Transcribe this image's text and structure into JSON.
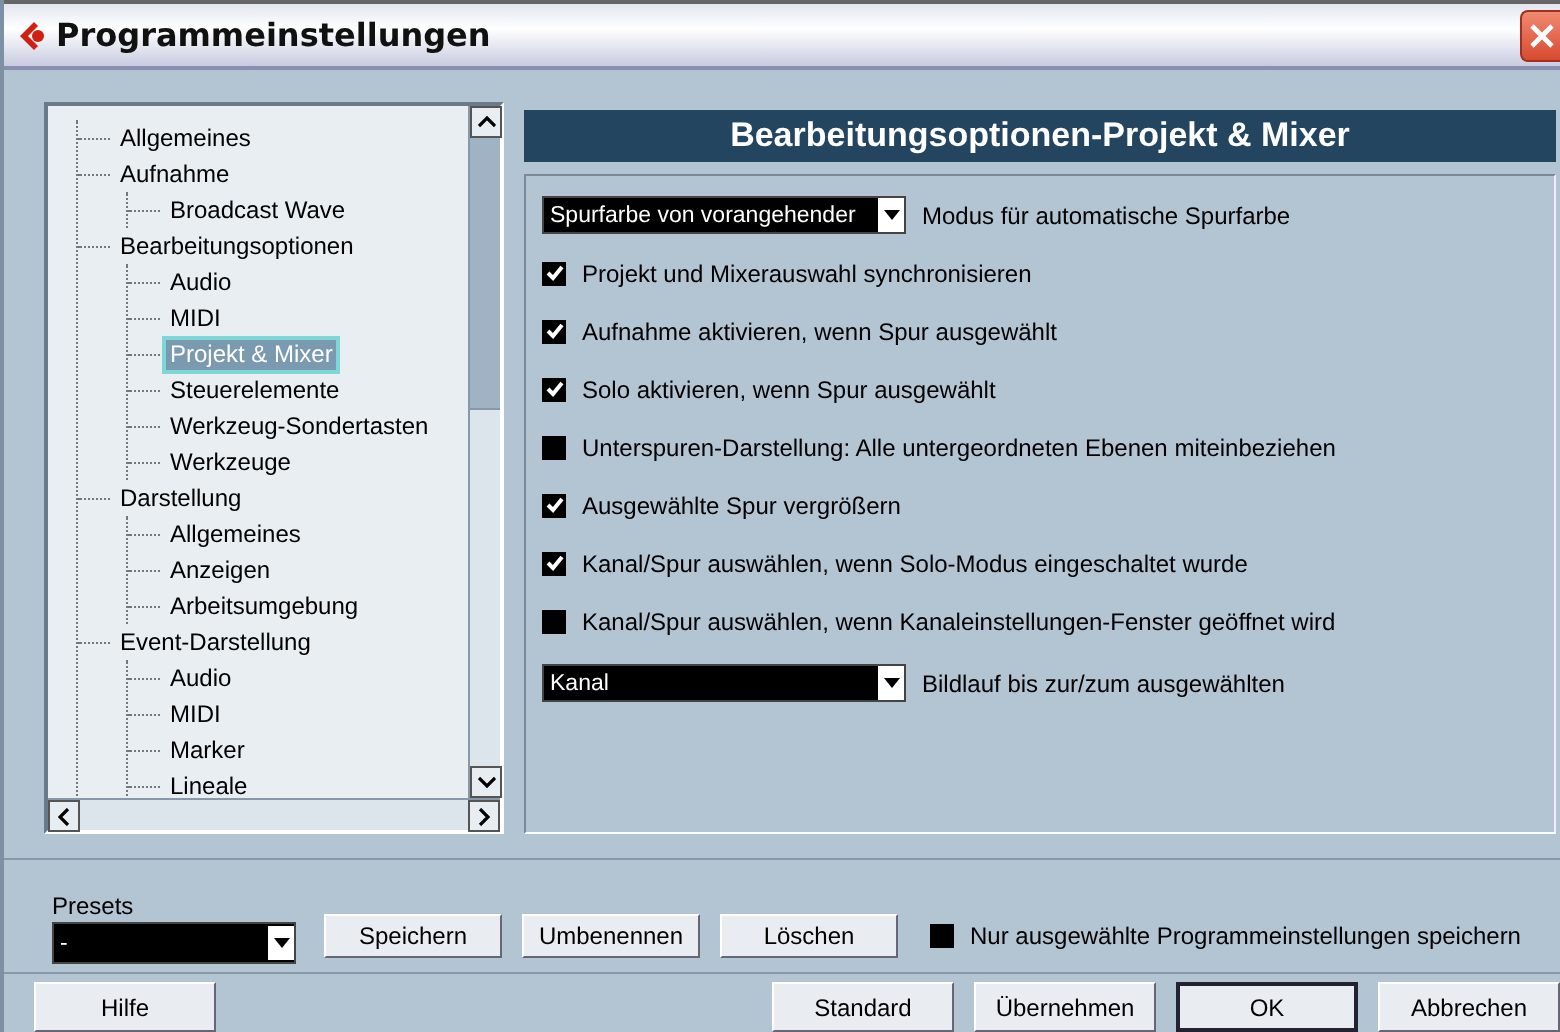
{
  "window": {
    "title": "Programmeinstellungen"
  },
  "tree": {
    "items": [
      {
        "label": "Allgemeines",
        "selected": false
      },
      {
        "label": "Aufnahme",
        "selected": false,
        "children": [
          {
            "label": "Broadcast Wave",
            "selected": false
          }
        ]
      },
      {
        "label": "Bearbeitungsoptionen",
        "selected": false,
        "children": [
          {
            "label": "Audio",
            "selected": false
          },
          {
            "label": "MIDI",
            "selected": false
          },
          {
            "label": "Projekt & Mixer",
            "selected": true
          },
          {
            "label": "Steuerelemente",
            "selected": false
          },
          {
            "label": "Werkzeug-Sondertasten",
            "selected": false
          },
          {
            "label": "Werkzeuge",
            "selected": false
          }
        ]
      },
      {
        "label": "Darstellung",
        "selected": false,
        "children": [
          {
            "label": "Allgemeines",
            "selected": false
          },
          {
            "label": "Anzeigen",
            "selected": false
          },
          {
            "label": "Arbeitsumgebung",
            "selected": false
          }
        ]
      },
      {
        "label": "Event-Darstellung",
        "selected": false,
        "children": [
          {
            "label": "Audio",
            "selected": false
          },
          {
            "label": "MIDI",
            "selected": false
          },
          {
            "label": "Marker",
            "selected": false
          },
          {
            "label": "Lineale",
            "selected": false
          }
        ]
      }
    ]
  },
  "panel": {
    "title": "Bearbeitungsoptionen-Projekt & Mixer",
    "options": [
      {
        "kind": "dropdown",
        "selection": "Spurfarbe von vorangehender",
        "caption": "Modus für automatische Spurfarbe"
      },
      {
        "kind": "checkbox",
        "checked": true,
        "label": "Projekt und Mixerauswahl synchronisieren"
      },
      {
        "kind": "checkbox",
        "checked": true,
        "label": "Aufnahme aktivieren, wenn Spur ausgewählt"
      },
      {
        "kind": "checkbox",
        "checked": true,
        "label": "Solo aktivieren, wenn Spur ausgewählt"
      },
      {
        "kind": "checkbox",
        "checked": false,
        "label": "Unterspuren-Darstellung: Alle untergeordneten Ebenen miteinbeziehen"
      },
      {
        "kind": "checkbox",
        "checked": true,
        "label": "Ausgewählte Spur vergrößern"
      },
      {
        "kind": "checkbox",
        "checked": true,
        "label": "Kanal/Spur auswählen, wenn Solo-Modus eingeschaltet wurde"
      },
      {
        "kind": "checkbox",
        "checked": false,
        "label": "Kanal/Spur auswählen, wenn Kanaleinstellungen-Fenster geöffnet wird"
      },
      {
        "kind": "dropdown",
        "selection": "Kanal",
        "caption": "Bildlauf bis zur/zum ausgewählten"
      }
    ]
  },
  "presets": {
    "label": "Presets",
    "value": "-",
    "buttons": [
      "Speichern",
      "Umbenennen",
      "Löschen"
    ],
    "only_selected": {
      "checked": false,
      "label": "Nur ausgewählte Programmeinstellungen speichern"
    }
  },
  "footer": {
    "help": "Hilfe",
    "buttons": [
      {
        "label": "Standard",
        "default": false
      },
      {
        "label": "Übernehmen",
        "default": false
      },
      {
        "label": "OK",
        "default": true
      },
      {
        "label": "Abbrechen",
        "default": false
      }
    ]
  }
}
